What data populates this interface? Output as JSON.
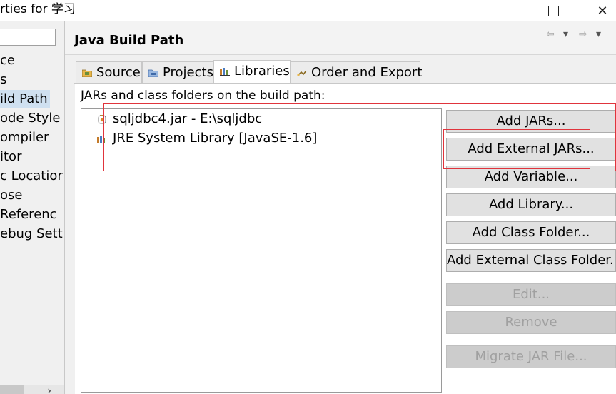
{
  "window": {
    "title": "rties for 学习",
    "min_glyph": "—",
    "max_glyph": "☐",
    "close_glyph": "✕"
  },
  "nav": {
    "items": [
      {
        "label": "ce",
        "selected": false
      },
      {
        "label": "s",
        "selected": false
      },
      {
        "label": "ild Path",
        "selected": true
      },
      {
        "label": "ode Style",
        "selected": false
      },
      {
        "label": "ompiler",
        "selected": false
      },
      {
        "label": "itor",
        "selected": false
      },
      {
        "label": "c Locatior",
        "selected": false
      },
      {
        "label": "ose",
        "selected": false
      },
      {
        "label": " Referenc",
        "selected": false
      },
      {
        "label": "ebug Setti",
        "selected": false
      }
    ],
    "scroll_arrow": "›"
  },
  "page": {
    "title": "Java Build Path",
    "back_glyph": "⇦",
    "back_menu_glyph": "▾",
    "fwd_glyph": "⇨",
    "fwd_menu_glyph": "▾"
  },
  "tabs": [
    {
      "label": "Source",
      "icon": "source-folder-icon",
      "active": false
    },
    {
      "label": "Projects",
      "icon": "projects-icon",
      "active": false
    },
    {
      "label": "Libraries",
      "icon": "libraries-icon",
      "active": true
    },
    {
      "label": "Order and Export",
      "icon": "order-export-icon",
      "active": false
    }
  ],
  "libraries": {
    "label": "JARs and class folders on the build path:",
    "entries": [
      {
        "text": "sqljdbc4.jar - E:\\sqljdbc",
        "icon": "jar-icon"
      },
      {
        "text": "JRE System Library [JavaSE-1.6]",
        "icon": "library-icon"
      }
    ]
  },
  "buttons": [
    {
      "label": "Add JARs...",
      "enabled": true
    },
    {
      "label": "Add External JARs...",
      "enabled": true
    },
    {
      "label": "Add Variable...",
      "enabled": true
    },
    {
      "label": "Add Library...",
      "enabled": true
    },
    {
      "label": "Add Class Folder...",
      "enabled": true
    },
    {
      "label": "Add External Class Folder...",
      "enabled": true
    },
    {
      "label": "Edit...",
      "enabled": false
    },
    {
      "label": "Remove",
      "enabled": false
    },
    {
      "label": "Migrate JAR File...",
      "enabled": false
    }
  ],
  "colors": {
    "annotation_red": "#e0343c",
    "selected_nav": "#cfe0f0",
    "disabled_text": "#a0a0a0"
  }
}
